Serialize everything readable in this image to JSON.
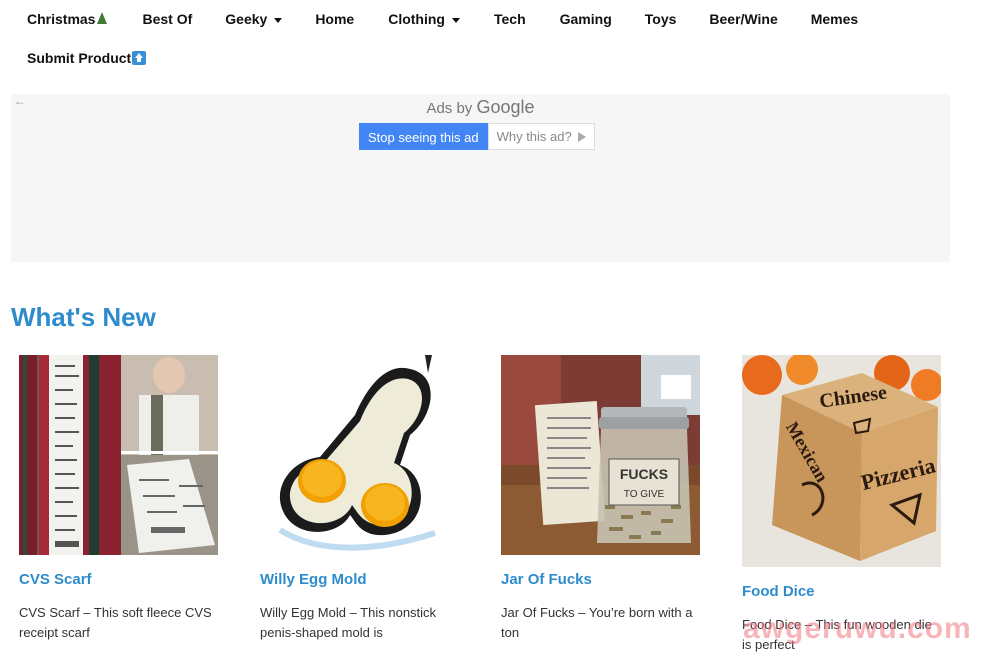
{
  "nav": {
    "items": [
      {
        "label": "Christmas",
        "icon": "tree-icon"
      },
      {
        "label": "Best Of"
      },
      {
        "label": "Geeky",
        "dropdown": true
      },
      {
        "label": "Home"
      },
      {
        "label": "Clothing",
        "dropdown": true
      },
      {
        "label": "Tech"
      },
      {
        "label": "Gaming"
      },
      {
        "label": "Toys"
      },
      {
        "label": "Beer/Wine"
      },
      {
        "label": "Memes"
      }
    ],
    "submit": {
      "label": "Submit Product",
      "icon": "up-arrow-icon"
    }
  },
  "ad": {
    "back": "←",
    "ads_by": "Ads by",
    "google": "Google",
    "stop_label": "Stop seeing this ad",
    "why_label": "Why this ad?"
  },
  "section": {
    "title": "What's New"
  },
  "products": [
    {
      "title": "CVS Scarf",
      "desc": "CVS Scarf – This soft fleece CVS receipt scarf"
    },
    {
      "title": "Willy Egg Mold",
      "desc": "Willy Egg Mold – This nonstick penis-shaped mold is"
    },
    {
      "title": "Jar Of Fucks",
      "desc": "Jar Of Fucks – You’re born with a ton"
    },
    {
      "title": "Food Dice",
      "desc": "Food Dice – This fun wooden die is perfect"
    }
  ],
  "images": {
    "jar_label1": "FUCKS",
    "jar_label2": "TO GIVE",
    "dice_top": "Chinese",
    "dice_left": "Mexican",
    "dice_right": "Pizzeria"
  },
  "watermark": "awgeruwu.com",
  "colors": {
    "accent": "#2f8ccc",
    "ad_button": "#4285f4"
  }
}
